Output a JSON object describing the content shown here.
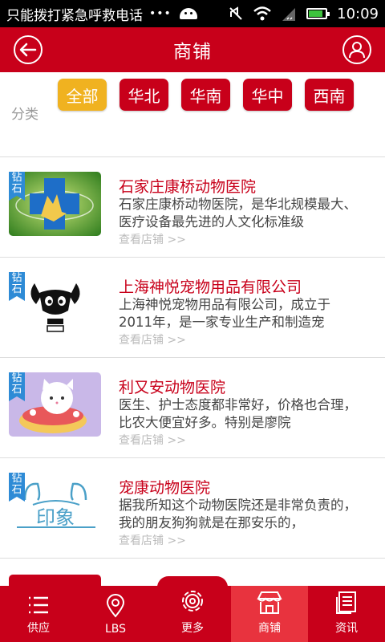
{
  "status_bar": {
    "carrier": "只能拨打紧急呼救电话",
    "dots": "•••",
    "time": "10:09"
  },
  "header": {
    "title": "商铺",
    "back_icon": "back-arrow-icon",
    "user_icon": "user-icon"
  },
  "filter": {
    "label": "分类",
    "chips": [
      "全部",
      "华北",
      "华南",
      "华中",
      "西南"
    ],
    "active_index": 0
  },
  "shops": [
    {
      "badge": [
        "钻",
        "石"
      ],
      "name": "石家庄康桥动物医院",
      "desc": "石家庄康桥动物医院，是华北规模最大、医疗设备最先进的人文化标准级",
      "more": "查看店铺 >>"
    },
    {
      "badge": [
        "钻",
        "石"
      ],
      "name": "上海神悦宠物用品有限公司",
      "desc": "上海神悦宠物用品有限公司，成立于2011年，是一家专业生产和制造宠",
      "more": "查看店铺 >>"
    },
    {
      "badge": [
        "钻",
        "石"
      ],
      "name": "利又安动物医院",
      "desc": "医生、护士态度都非常好，价格也合理，比农大便宜好多。特别是廖院",
      "more": "查看店铺 >>"
    },
    {
      "badge": [
        "钻",
        "石"
      ],
      "name": "宠康动物医院",
      "desc": "据我所知这个动物医院还是非常负责的，我的朋友狗狗就是在那安乐的，",
      "more": "查看店铺 >>",
      "logo_text": "印象"
    }
  ],
  "bottom_nav": [
    {
      "label": "供应",
      "icon": "list-icon"
    },
    {
      "label": "LBS",
      "icon": "location-pin-icon"
    },
    {
      "label": "更多",
      "icon": "gear-icon"
    },
    {
      "label": "商铺",
      "icon": "store-icon",
      "selected": true
    },
    {
      "label": "资讯",
      "icon": "news-icon"
    }
  ],
  "colors": {
    "brand_red": "#c8001a",
    "active_chip": "#f0b220",
    "selected_tab": "#e8333e",
    "badge_blue": "#2e8bd6"
  }
}
